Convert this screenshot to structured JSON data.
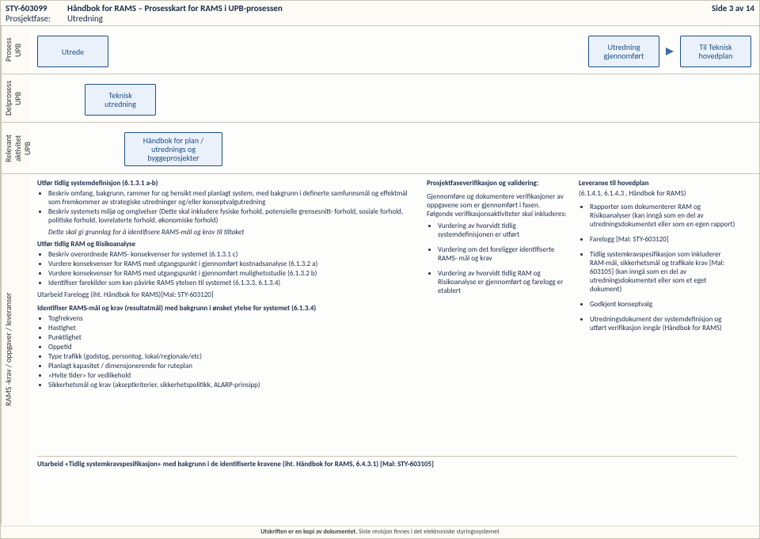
{
  "header": {
    "doc_id": "STY-603099",
    "title": "Håndbok for RAMS – Prosesskart for RAMS i UPB-prosessen",
    "phase_label": "Prosjektfase:",
    "phase_value": "Utredning",
    "page_label": "Side 3 av 14"
  },
  "lanes": {
    "l1": "Prosess\nUPB",
    "l2": "Delprosess\nUPB",
    "l3": "Relevant\naktivitet UPB",
    "l4": "RAMS -krav / oppgaver / leveranser"
  },
  "flow": {
    "utrede": "Utrede",
    "gjennomfort": "Utredning\ngjennomført",
    "til_teknisk": "Til Teknisk\nhovedplan",
    "teknisk_utredning": "Teknisk\nutredning",
    "handbok": "Håndbok for plan /\nutrednings og\nbyggeprosjekter"
  },
  "rams": {
    "c1": {
      "h1": "Utfør tidlig systemdefinisjon (6.1.3.1 a-b)",
      "b1a": "Beskriv omfang, bakgrunn, rammer for og hensikt med planlagt system, med bakgrunn i definerte samfunnsmål og effektmål som fremkommer av strategiske utredninger og/eller konseptvalgutredning",
      "b1b": "Beskriv systemets miljø og omgivelser (Dette skal inkludere fysiske forhold, potensielle grensesnitt- forhold, sosiale forhold, politiske forhold, lovrelaterte forhold, økonomiske forhold)",
      "note1": "Dette skal gi grunnlag for å identifisere RAMS-mål og krav til tiltaket",
      "h2": "Utfør tidlig RAM og Risikoanalyse",
      "b2a": "Beskriv overordnede RAMS- konsekvenser for systemet (6.1.3.1 c)",
      "b2b": "Vurdere konsekvenser for RAMS med utgangspunkt i gjennomført kostnadsanalyse (6.1.3.2 a)",
      "b2c": "Vurdere konsekvenser for RAMS med utgangspunkt i gjennomført mulighetsstudie (6.1.3.2 b)",
      "b2d": "Identifiser farekilder som kan påvirke RAMS ytelsen til systemet (6.1.3.3, 6.1.3.4)",
      "h2b": "Utarbeid Farelogg (iht. Håndbok for RAMS)[Mal: STY-603120]",
      "h3": "Identifiser RAMS-mål og krav (resultatmål) med bakgrunn i ønsket ytelse for systemet (6.1.3.4)",
      "b3a": "Togfrekvens",
      "b3b": "Hastighet",
      "b3c": "Punktlighet",
      "b3d": "Oppetid",
      "b3e": "Type trafikk (godstog, persontog, lokal/regionale/etc)",
      "b3f": "Planlagt kapasitet / dimensjonerende for ruteplan",
      "b3g": "«Hvite tider» for vedlikehold",
      "b3h": "Sikkerhetsmål og krav (akseptkriterier, sikkerhetspolitikk, ALARP-prinsipp)"
    },
    "c2": {
      "h1": "Prosjektfaseverifikasjon og validering:",
      "p1": "Gjennomføre og dokumentere verifikasjoner av oppgavene som er gjennomført i fasen.",
      "p2": "Følgende verifikasjonsaktiviteter skal inkluderes:",
      "b1": "Vurdering av hvorvidt tidlig systemdefinisjonen er utført",
      "b2": "Vurdering om det foreligger identifiserte RAMS- mål og krav",
      "b3": "Vurdering av hvorvidt tidlig RAM og Risikoanalyse er gjennomført og farelogg er etablert"
    },
    "c3": {
      "h1": "Leveranse til hovedplan",
      "h1b": "(6.1.4.1, 6.1.4.3 , Håndbok for RAMS)",
      "b1": "Rapporter som dokumenterer RAM og Risikoanalyser (kan inngå som en del av utredningsdokumentet eller som en egen rapport)",
      "b2": "Farelogg [Mal: STY-603120]",
      "b3": "Tidlig systemkravspesifikasjon som inkluderer RAM-mål, sikkerhetsmål og trafikale krav [Mal: 603105] (kan inngå som en del av utredningsdokumentet eller som et eget dokument)",
      "b4": "Godkjent konseptvalg",
      "b5": "Utredningsdokument der systemdefinisjon og utført verifikasjon inngår (Håndbok for RAMS)"
    },
    "final": "Utarbeid «Tidlig systemkravspesifikasjon» med bakgrunn i de identifiserte kravene (iht. Håndbok for RAMS, 6.4.3.1) [Mal: STY-603105]"
  },
  "footer": {
    "bold": "Utskriften er en kopi av dokumentet.",
    "rest": " Siste revisjon finnes i det elektroniske styringssystemet"
  }
}
